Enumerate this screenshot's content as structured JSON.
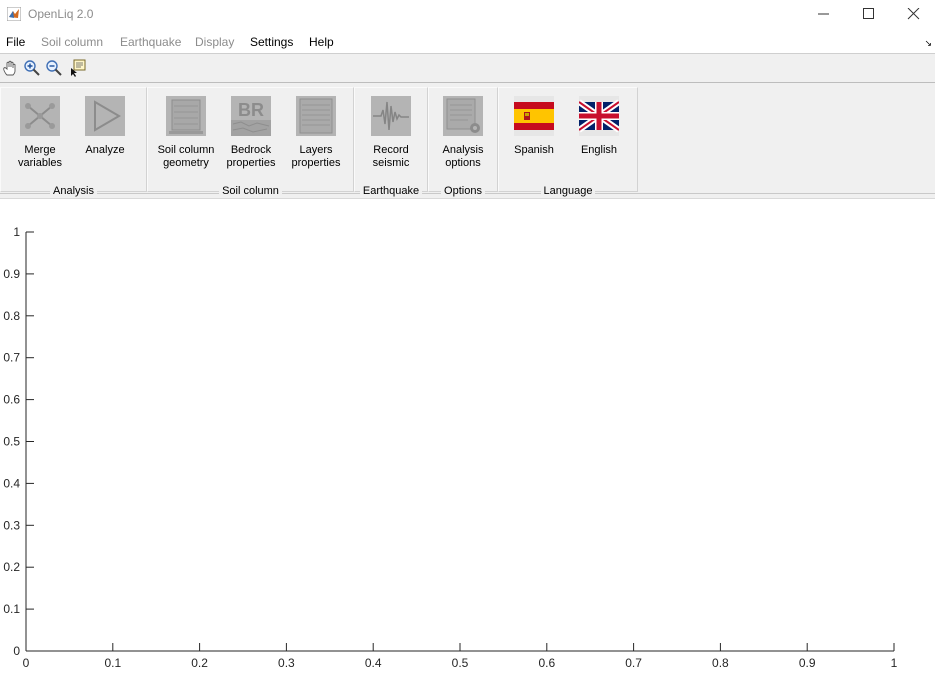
{
  "window": {
    "title": "OpenLiq 2.0"
  },
  "menu": [
    {
      "label": "File",
      "enabled": true
    },
    {
      "label": "Soil column",
      "enabled": false
    },
    {
      "label": "Earthquake",
      "enabled": false
    },
    {
      "label": "Display",
      "enabled": false
    },
    {
      "label": "Settings",
      "enabled": true
    },
    {
      "label": "Help",
      "enabled": true
    }
  ],
  "toolbar": {
    "tools": [
      "pan-icon",
      "zoom-in-icon",
      "zoom-out-icon",
      "data-cursor-icon"
    ]
  },
  "ribbon": {
    "panels": [
      {
        "title": "Analysis",
        "buttons": [
          {
            "label_l1": "Merge",
            "label_l2": "variables",
            "icon": "merge-variables-icon"
          },
          {
            "label_l1": "Analyze",
            "label_l2": "",
            "icon": "play-icon"
          }
        ]
      },
      {
        "title": "Soil column",
        "buttons": [
          {
            "label_l1": "Soil column",
            "label_l2": "geometry",
            "icon": "soil-column-icon"
          },
          {
            "label_l1": "Bedrock",
            "label_l2": "properties",
            "icon": "bedrock-icon",
            "icon_text": "BR"
          },
          {
            "label_l1": "Layers",
            "label_l2": "properties",
            "icon": "layers-icon"
          }
        ]
      },
      {
        "title": "Earthquake",
        "buttons": [
          {
            "label_l1": "Record",
            "label_l2": "seismic",
            "icon": "seismograph-icon"
          }
        ]
      },
      {
        "title": "Options",
        "buttons": [
          {
            "label_l1": "Analysis",
            "label_l2": "options",
            "icon": "analysis-options-icon"
          }
        ]
      },
      {
        "title": "Language",
        "buttons": [
          {
            "label_l1": "Spanish",
            "label_l2": "",
            "icon": "spain-flag-icon"
          },
          {
            "label_l1": "English",
            "label_l2": "",
            "icon": "uk-flag-icon"
          }
        ]
      }
    ]
  },
  "axes": {
    "xticks": [
      "0",
      "0.1",
      "0.2",
      "0.3",
      "0.4",
      "0.5",
      "0.6",
      "0.7",
      "0.8",
      "0.9",
      "1"
    ],
    "yticks": [
      "0",
      "0.1",
      "0.2",
      "0.3",
      "0.4",
      "0.5",
      "0.6",
      "0.7",
      "0.8",
      "0.9",
      "1"
    ],
    "xlim": [
      0,
      1
    ],
    "ylim": [
      0,
      1
    ]
  }
}
